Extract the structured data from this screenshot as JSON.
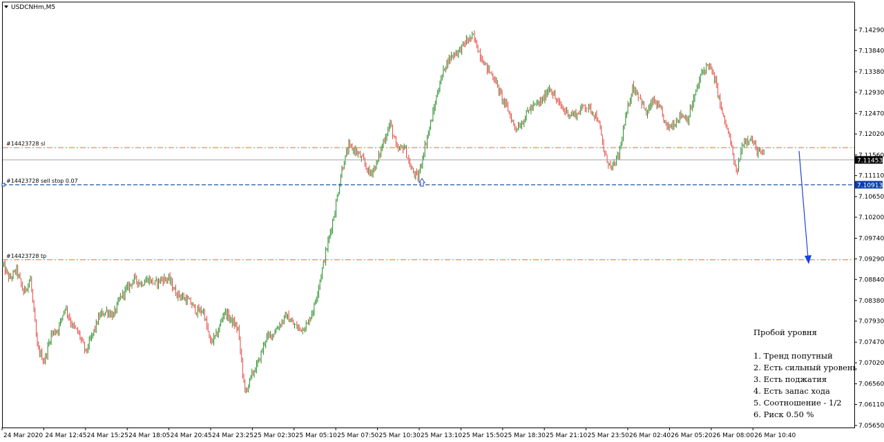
{
  "window": {
    "title": "USDCNHm,M5"
  },
  "colors": {
    "bull": "#228B22",
    "bear": "#E8433C",
    "level_line": "#FF6A00",
    "order_line": "#003C9E",
    "current_tag_bg": "#000000",
    "order_tag_bg": "#0A3FA8",
    "arrow": "#1E40D8",
    "axis": "#000000"
  },
  "chart_data": {
    "type": "candlestick",
    "symbol": "USDCNHm",
    "timeframe": "M5",
    "y_axis": {
      "ylim": [
        7.0565,
        7.14525
      ],
      "ticks": [
        "7.14290",
        "7.13840",
        "7.13380",
        "7.12930",
        "7.12470",
        "7.12020",
        "7.11560",
        "7.11110",
        "7.10650",
        "7.10200",
        "7.09740",
        "7.09290",
        "7.08840",
        "7.08380",
        "7.07930",
        "7.07470",
        "7.07020",
        "7.06560",
        "7.06110",
        "7.05650"
      ]
    },
    "x_axis": {
      "ticks": [
        "24 Mar 2020",
        "24 Mar 12:45",
        "24 Mar 15:25",
        "24 Mar 18:05",
        "24 Mar 20:45",
        "24 Mar 23:25",
        "25 Mar 02:30",
        "25 Mar 05:10",
        "25 Mar 07:50",
        "25 Mar 10:30",
        "25 Mar 13:10",
        "25 Mar 15:50",
        "25 Mar 18:30",
        "25 Mar 21:10",
        "25 Mar 23:50",
        "26 Mar 02:40",
        "26 Mar 05:20",
        "26 Mar 08:00",
        "26 Mar 10:40"
      ]
    },
    "price_path": [
      [
        0,
        7.0915
      ],
      [
        6,
        7.0885
      ],
      [
        12,
        7.0905
      ],
      [
        18,
        7.0855
      ],
      [
        24,
        7.0885
      ],
      [
        30,
        7.0735
      ],
      [
        36,
        7.0705
      ],
      [
        42,
        7.0765
      ],
      [
        48,
        7.0775
      ],
      [
        54,
        7.0825
      ],
      [
        60,
        7.0785
      ],
      [
        66,
        7.0765
      ],
      [
        72,
        7.0725
      ],
      [
        78,
        7.0765
      ],
      [
        84,
        7.0805
      ],
      [
        90,
        7.0815
      ],
      [
        96,
        7.0805
      ],
      [
        102,
        7.0845
      ],
      [
        108,
        7.0865
      ],
      [
        114,
        7.0885
      ],
      [
        120,
        7.0875
      ],
      [
        126,
        7.0885
      ],
      [
        132,
        7.0875
      ],
      [
        138,
        7.0885
      ],
      [
        144,
        7.0885
      ],
      [
        150,
        7.0855
      ],
      [
        156,
        7.0845
      ],
      [
        162,
        7.0835
      ],
      [
        168,
        7.0815
      ],
      [
        174,
        7.0815
      ],
      [
        180,
        7.0745
      ],
      [
        186,
        7.0765
      ],
      [
        192,
        7.0815
      ],
      [
        198,
        7.0795
      ],
      [
        204,
        7.0775
      ],
      [
        210,
        7.0635
      ],
      [
        216,
        7.0675
      ],
      [
        222,
        7.0705
      ],
      [
        228,
        7.0755
      ],
      [
        234,
        7.0765
      ],
      [
        240,
        7.0785
      ],
      [
        246,
        7.0805
      ],
      [
        252,
        7.0785
      ],
      [
        258,
        7.0775
      ],
      [
        264,
        7.0785
      ],
      [
        270,
        7.0825
      ],
      [
        276,
        7.0895
      ],
      [
        282,
        7.0965
      ],
      [
        288,
        7.1035
      ],
      [
        294,
        7.1125
      ],
      [
        300,
        7.1175
      ],
      [
        306,
        7.1165
      ],
      [
        312,
        7.1145
      ],
      [
        318,
        7.1115
      ],
      [
        324,
        7.1135
      ],
      [
        330,
        7.1185
      ],
      [
        336,
        7.1225
      ],
      [
        342,
        7.1165
      ],
      [
        348,
        7.1175
      ],
      [
        354,
        7.1125
      ],
      [
        360,
        7.1105
      ],
      [
        366,
        7.1175
      ],
      [
        372,
        7.1235
      ],
      [
        378,
        7.1305
      ],
      [
        384,
        7.1355
      ],
      [
        390,
        7.1375
      ],
      [
        396,
        7.1385
      ],
      [
        402,
        7.1405
      ],
      [
        408,
        7.1415
      ],
      [
        414,
        7.1375
      ],
      [
        420,
        7.1345
      ],
      [
        426,
        7.1325
      ],
      [
        432,
        7.1285
      ],
      [
        438,
        7.1255
      ],
      [
        444,
        7.1215
      ],
      [
        450,
        7.1225
      ],
      [
        456,
        7.1255
      ],
      [
        462,
        7.1265
      ],
      [
        468,
        7.1275
      ],
      [
        474,
        7.1305
      ],
      [
        480,
        7.1275
      ],
      [
        486,
        7.1255
      ],
      [
        492,
        7.1245
      ],
      [
        498,
        7.1245
      ],
      [
        504,
        7.1265
      ],
      [
        510,
        7.1255
      ],
      [
        516,
        7.1235
      ],
      [
        522,
        7.1155
      ],
      [
        528,
        7.1125
      ],
      [
        534,
        7.1155
      ],
      [
        540,
        7.1235
      ],
      [
        546,
        7.1305
      ],
      [
        552,
        7.1285
      ],
      [
        558,
        7.1245
      ],
      [
        564,
        7.1275
      ],
      [
        570,
        7.1255
      ],
      [
        576,
        7.1215
      ],
      [
        582,
        7.1225
      ],
      [
        588,
        7.1245
      ],
      [
        594,
        7.1235
      ],
      [
        600,
        7.1285
      ],
      [
        606,
        7.1335
      ],
      [
        612,
        7.1355
      ],
      [
        618,
        7.1315
      ],
      [
        624,
        7.1245
      ],
      [
        630,
        7.1195
      ],
      [
        636,
        7.1115
      ],
      [
        642,
        7.1185
      ],
      [
        648,
        7.1195
      ],
      [
        654,
        7.1165
      ],
      [
        660,
        7.1155
      ]
    ],
    "levels": [
      {
        "name": "stop-loss",
        "label": "#14423728 sl",
        "price": 7.1172,
        "style": "dashdot"
      },
      {
        "name": "sell-stop",
        "label": "#14423728 sell stop 0.07",
        "price": 7.1091,
        "style": "dashed-order"
      },
      {
        "name": "take-profit",
        "label": "#14423728 tp",
        "price": 7.0927,
        "style": "dashdot"
      }
    ],
    "current_price": 7.11453,
    "current_price_label": "7.11453",
    "order_price_label": "7.10913"
  },
  "notes": {
    "title": "Пробой уровня",
    "items": [
      "1. Тренд попутный",
      "2. Есть сильный уровень",
      "3. Есть поджатия",
      "4. Есть запас хода",
      "5. Соотношение - 1/2",
      "6. Риск 0.50 %"
    ]
  }
}
